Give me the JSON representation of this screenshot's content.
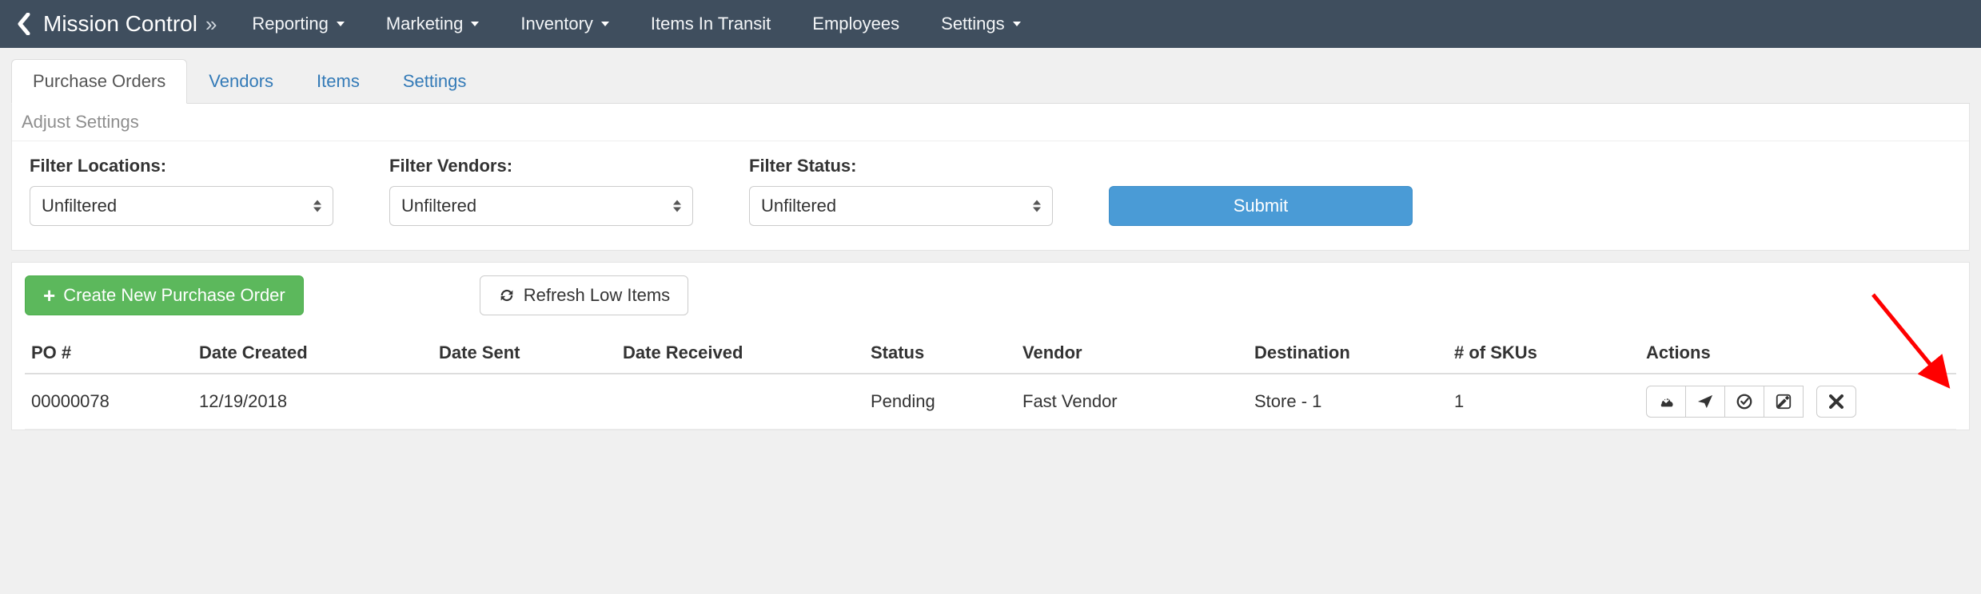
{
  "nav": {
    "brand": "Mission Control",
    "items": [
      {
        "label": "Reporting",
        "caret": true
      },
      {
        "label": "Marketing",
        "caret": true
      },
      {
        "label": "Inventory",
        "caret": true
      },
      {
        "label": "Items In Transit",
        "caret": false
      },
      {
        "label": "Employees",
        "caret": false
      },
      {
        "label": "Settings",
        "caret": true
      }
    ]
  },
  "tabs": [
    {
      "label": "Purchase Orders",
      "active": true
    },
    {
      "label": "Vendors",
      "active": false
    },
    {
      "label": "Items",
      "active": false
    },
    {
      "label": "Settings",
      "active": false
    }
  ],
  "subhead": "Adjust Settings",
  "filters": {
    "locations": {
      "label": "Filter Locations:",
      "value": "Unfiltered"
    },
    "vendors": {
      "label": "Filter Vendors:",
      "value": "Unfiltered"
    },
    "status": {
      "label": "Filter Status:",
      "value": "Unfiltered"
    },
    "submit": "Submit"
  },
  "buttons": {
    "create": "Create New Purchase Order",
    "refresh": "Refresh Low Items"
  },
  "table": {
    "headers": [
      "PO #",
      "Date Created",
      "Date Sent",
      "Date Received",
      "Status",
      "Vendor",
      "Destination",
      "# of SKUs",
      "Actions"
    ],
    "rows": [
      {
        "po": "00000078",
        "created": "12/19/2018",
        "sent": "",
        "received": "",
        "status": "Pending",
        "vendor": "Fast Vendor",
        "destination": "Store - 1",
        "skus": "1"
      }
    ]
  },
  "action_icons": [
    "receive-icon",
    "send-icon",
    "complete-icon",
    "edit-icon"
  ],
  "delete_icon": "delete-icon"
}
